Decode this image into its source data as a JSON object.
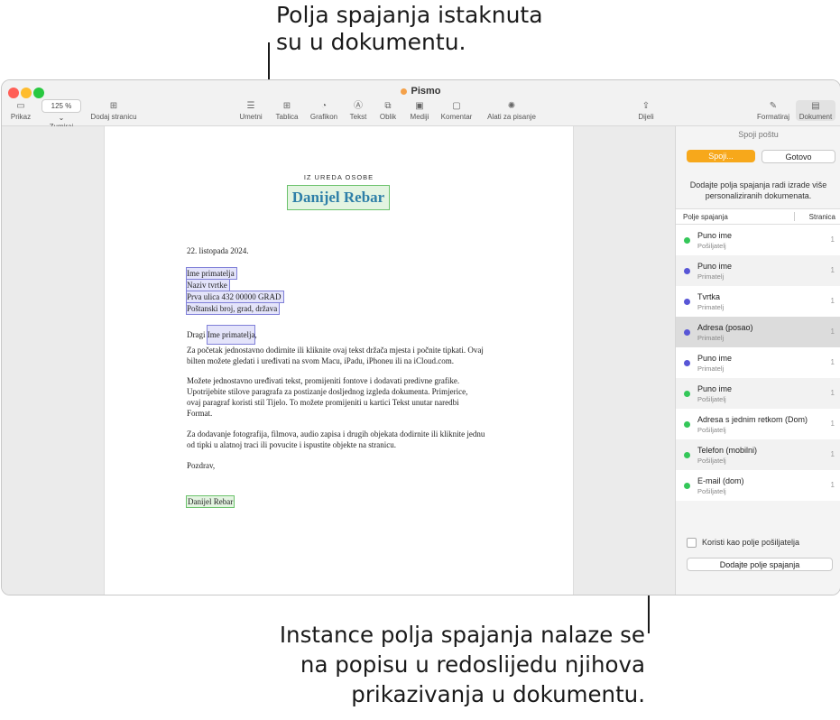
{
  "callouts": {
    "top": [
      "Polja spajanja istaknuta",
      "su u dokumentu."
    ],
    "bottom": [
      "Instance polja spajanja nalaze se",
      "na popisu u redoslijedu njihova",
      "prikazivanja u dokumentu."
    ]
  },
  "window": {
    "title": "Pismo"
  },
  "toolbar": {
    "view": "Prikaz",
    "zoom_value": "125 %",
    "zoom": "Zumiraj",
    "add_page": "Dodaj stranicu",
    "insert": "Umetni",
    "table": "Tablica",
    "chart": "Grafikon",
    "text": "Tekst",
    "shape": "Oblik",
    "media": "Mediji",
    "comment": "Komentar",
    "writing_tools": "Alati za pisanje",
    "share": "Dijeli",
    "format": "Formatiraj",
    "document": "Dokument"
  },
  "document": {
    "header": "IZ UREDA OSOBE",
    "name": "Danijel Rebar",
    "date": "22. listopada 2024.",
    "address": [
      "Ime primatelja",
      "Naziv tvrtke",
      "Prva ulica 432 00000 GRAD",
      "Poštanski broj, grad, država"
    ],
    "greeting_prefix": "Dragi ",
    "greeting_field": "Ime primatelja",
    "greeting_suffix": ",",
    "p1": [
      "Za početak jednostavno dodirnite ili kliknite ovaj tekst držača mjesta i počnite tipkati. Ovaj",
      "bilten možete gledati i uređivati na svom Macu, iPadu, iPhoneu ili na iCloud.com."
    ],
    "p2": [
      "Možete jednostavno uređivati tekst, promijeniti fontove i dodavati predivne grafike.",
      "Upotrijebite stilove paragrafa za postizanje dosljednog izgleda dokumenta. Primjerice,",
      "ovaj paragraf koristi stil Tijelo. To možete promijeniti u kartici Tekst unutar naredbi",
      "Format."
    ],
    "p3": [
      "Za dodavanje fotografija, filmova, audio zapisa i drugih objekata dodirnite ili kliknite jednu",
      "od tipki u alatnoj traci ili povucite i ispustite objekte na stranicu."
    ],
    "closing": "Pozdrav,",
    "signature": "Danijel Rebar"
  },
  "sidebar": {
    "title": "Spoji poštu",
    "merge_button": "Spoji...",
    "done_button": "Gotovo",
    "description": [
      "Dodajte polja spajanja radi izrade više",
      "personaliziranih dokumenata."
    ],
    "col_field": "Polje spajanja",
    "col_page": "Stranica",
    "fields": [
      {
        "name": "Puno ime",
        "source": "Pošiljatelj",
        "page": "1",
        "color": "#34c759"
      },
      {
        "name": "Puno ime",
        "source": "Primatelj",
        "page": "1",
        "color": "#5856d6"
      },
      {
        "name": "Tvrtka",
        "source": "Primatelj",
        "page": "1",
        "color": "#5856d6"
      },
      {
        "name": "Adresa (posao)",
        "source": "Primatelj",
        "page": "1",
        "color": "#5856d6"
      },
      {
        "name": "Puno ime",
        "source": "Primatelj",
        "page": "1",
        "color": "#5856d6"
      },
      {
        "name": "Puno ime",
        "source": "Pošiljatelj",
        "page": "1",
        "color": "#34c759"
      },
      {
        "name": "Adresa s jednim retkom (Dom)",
        "source": "Pošiljatelj",
        "page": "1",
        "color": "#34c759"
      },
      {
        "name": "Telefon (mobilni)",
        "source": "Pošiljatelj",
        "page": "1",
        "color": "#34c759"
      },
      {
        "name": "E-mail (dom)",
        "source": "Pošiljatelj",
        "page": "1",
        "color": "#34c759"
      }
    ],
    "use_as_sender": "Koristi kao polje pošiljatelja",
    "add_field_button": "Dodajte polje spajanja"
  }
}
